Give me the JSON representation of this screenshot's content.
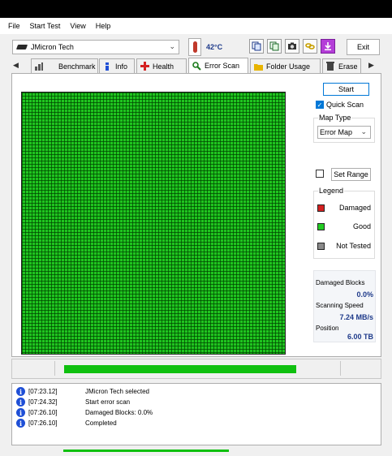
{
  "menu": [
    "File",
    "Start Test",
    "View",
    "Help"
  ],
  "toolbar": {
    "drive": "JMicron Tech",
    "temperature": "42°C",
    "exit_label": "Exit",
    "tools": [
      "copy-icon",
      "copy-text-icon",
      "camera-icon",
      "link-icon",
      "save-arrow-icon"
    ]
  },
  "tabs": [
    {
      "label": "Benchmark",
      "icon": "benchmark-icon",
      "active": false
    },
    {
      "label": "Info",
      "icon": "info-icon",
      "active": false
    },
    {
      "label": "Health",
      "icon": "health-icon",
      "active": false
    },
    {
      "label": "Error Scan",
      "icon": "magnifier-icon",
      "active": true
    },
    {
      "label": "Folder Usage",
      "icon": "folder-icon",
      "active": false
    },
    {
      "label": "Erase",
      "icon": "trash-icon",
      "active": false
    }
  ],
  "scan": {
    "start_label": "Start",
    "quick_scan_label": "Quick Scan",
    "quick_scan_checked": true,
    "map_type_title": "Map Type",
    "map_type_value": "Error Map",
    "set_range_label": "Set Range",
    "set_range_checked": false
  },
  "legend": {
    "title": "Legend",
    "items": [
      {
        "label": "Damaged",
        "color": "#d42020"
      },
      {
        "label": "Good",
        "color": "#22cc22"
      },
      {
        "label": "Not Tested",
        "color": "#8a8a8a"
      }
    ]
  },
  "stats": {
    "damaged_label": "Damaged Blocks",
    "damaged_value": "0.0%",
    "speed_label": "Scanning Speed",
    "speed_value": "7.24 MB/s",
    "position_label": "Position",
    "position_value": "6.00 TB"
  },
  "progress": {
    "fraction": 1.0,
    "color": "#0fc00f"
  },
  "log": [
    {
      "time": "[07:23.12]",
      "message": "JMicron Tech selected"
    },
    {
      "time": "[07:24.32]",
      "message": "Start error scan"
    },
    {
      "time": "[07:26.10]",
      "message": "Damaged Blocks: 0.0%"
    },
    {
      "time": "[07:26.10]",
      "message": "Completed"
    }
  ]
}
